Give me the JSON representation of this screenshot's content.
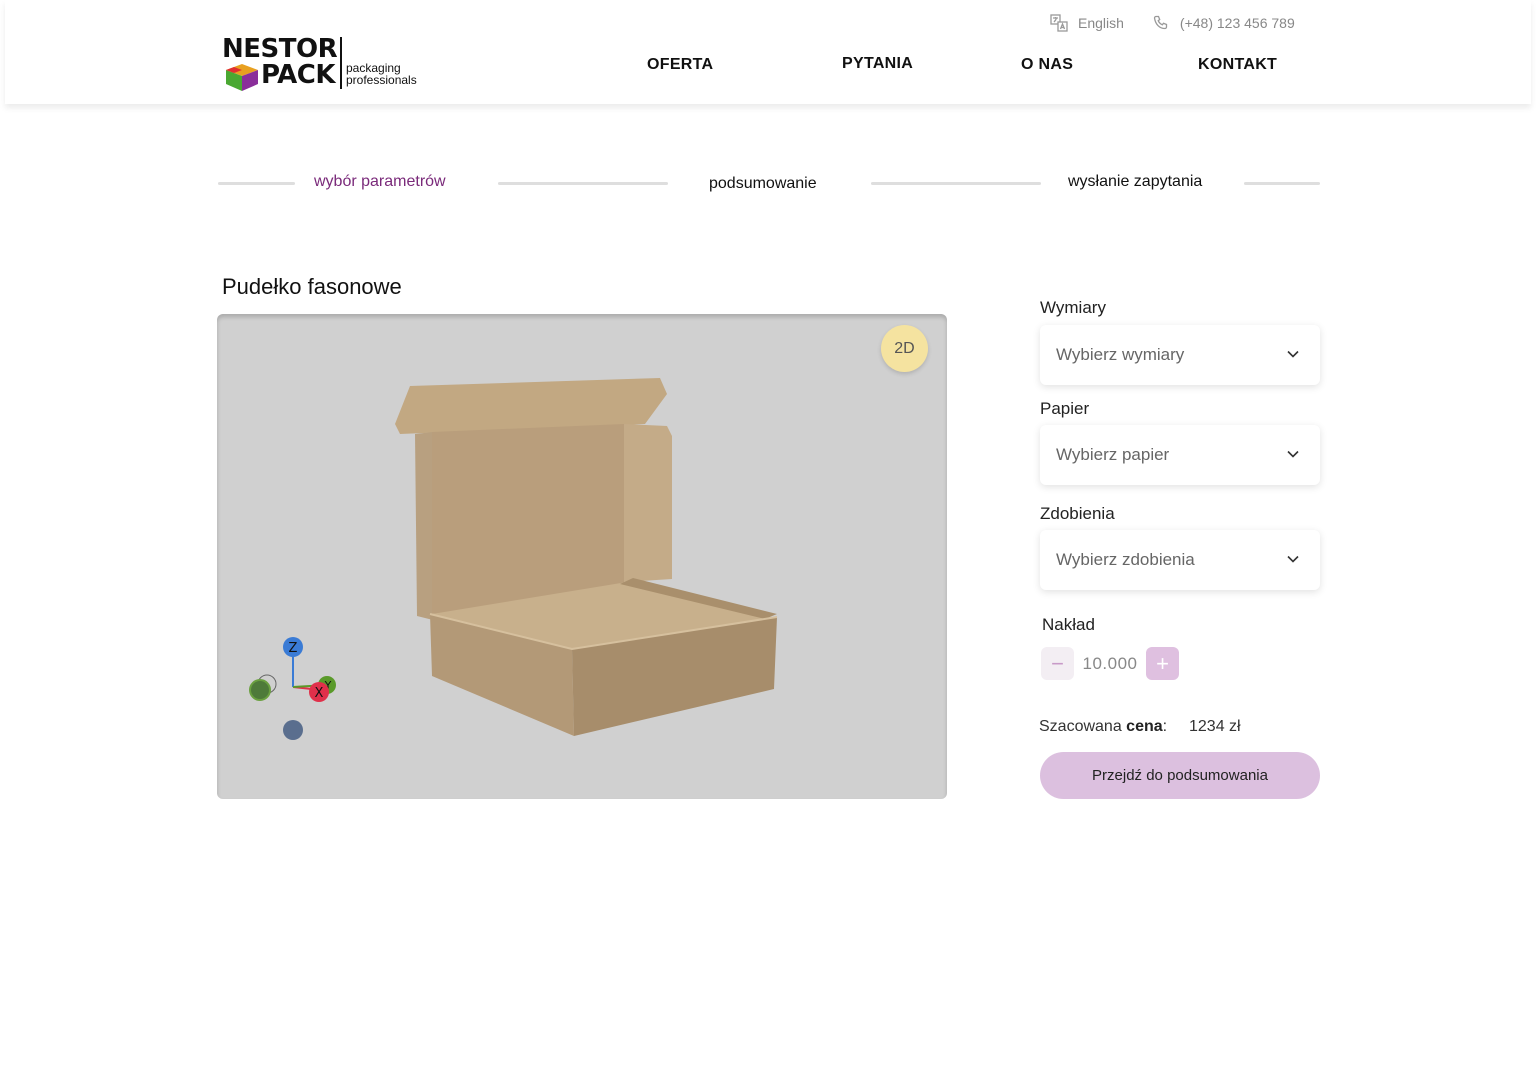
{
  "brand": {
    "logo_line1": "NESTOR",
    "logo_line2": "PACK",
    "tagline1": "packaging",
    "tagline2": "professionals"
  },
  "topbar": {
    "language": "English",
    "phone": "(+48) 123 456 789"
  },
  "nav": {
    "items": [
      "OFERTA",
      "PYTANIA",
      "O NAS",
      "KONTAKT"
    ]
  },
  "steps": {
    "items": [
      "wybór parametrów",
      "podsumowanie",
      "wysłanie zapytania"
    ],
    "active_color": "#7a2a7a"
  },
  "product": {
    "title": "Pudełko fasonowe",
    "view_toggle": "2D"
  },
  "form": {
    "dimensions_label": "Wymiary",
    "dimensions_placeholder": "Wybierz wymiary",
    "paper_label": "Papier",
    "paper_placeholder": "Wybierz papier",
    "decoration_label": "Zdobienia",
    "decoration_placeholder": "Wybierz zdobienia",
    "quantity_label": "Nakład",
    "quantity_value": "10.000",
    "price_label_prefix": "Szacowana",
    "price_label_bold": "cena",
    "price_label_suffix": ":",
    "price_value": "1234 zł",
    "cta": "Przejdź do podsumowania"
  },
  "gizmo": {
    "z": "Z",
    "y": "Y",
    "x": "X"
  },
  "colors": {
    "accent": "#dcc0df",
    "viewer_bg": "#d0d0d0",
    "cardboard": "#b49b78",
    "toggle_bg": "#f5e3a0"
  }
}
